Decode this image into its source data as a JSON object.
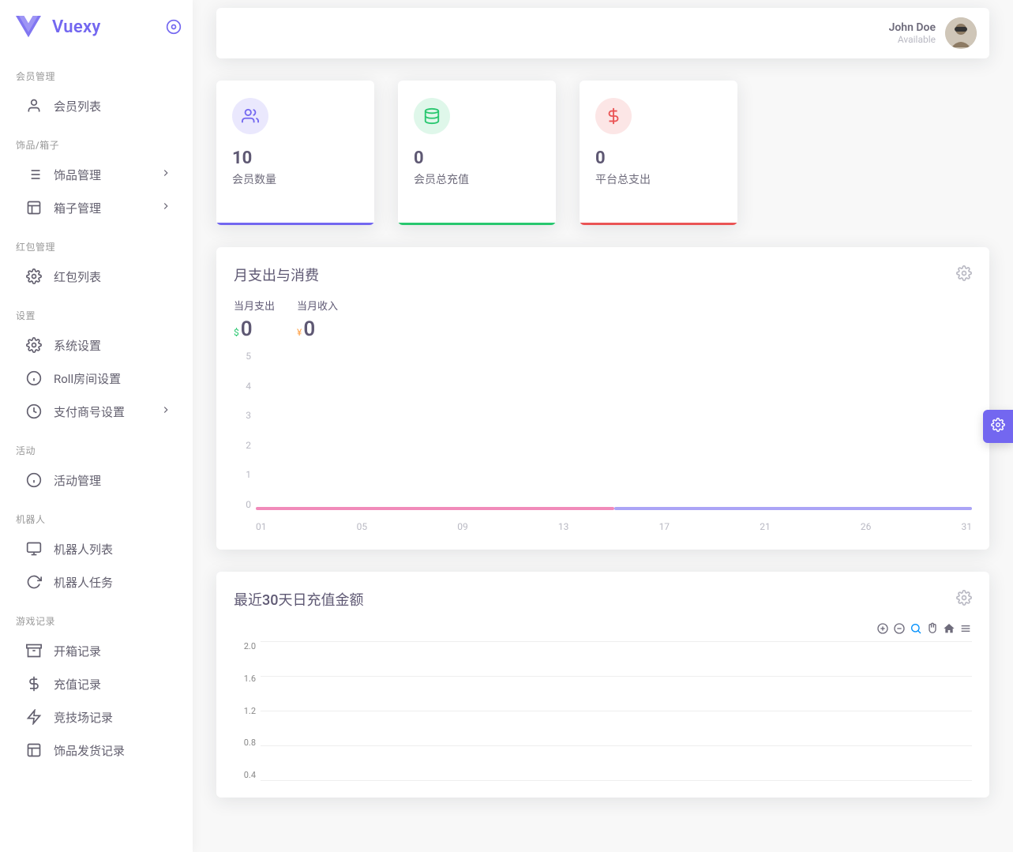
{
  "brand": {
    "name": "Vuexy"
  },
  "user": {
    "name": "John Doe",
    "status": "Available"
  },
  "sidebar": {
    "sections": [
      {
        "title": "会员管理",
        "items": [
          {
            "label": "会员列表",
            "icon": "user-icon"
          }
        ]
      },
      {
        "title": "饰品/箱子",
        "items": [
          {
            "label": "饰品管理",
            "icon": "list-icon",
            "chevron": true
          },
          {
            "label": "箱子管理",
            "icon": "layout-icon",
            "chevron": true
          }
        ]
      },
      {
        "title": "红包管理",
        "items": [
          {
            "label": "红包列表",
            "icon": "gear-icon"
          }
        ]
      },
      {
        "title": "设置",
        "items": [
          {
            "label": "系统设置",
            "icon": "gear-icon"
          },
          {
            "label": "Roll房间设置",
            "icon": "info-icon"
          },
          {
            "label": "支付商号设置",
            "icon": "clock-icon",
            "chevron": true
          }
        ]
      },
      {
        "title": "活动",
        "items": [
          {
            "label": "活动管理",
            "icon": "info-icon"
          }
        ]
      },
      {
        "title": "机器人",
        "items": [
          {
            "label": "机器人列表",
            "icon": "monitor-icon"
          },
          {
            "label": "机器人任务",
            "icon": "refresh-icon"
          }
        ]
      },
      {
        "title": "游戏记录",
        "items": [
          {
            "label": "开箱记录",
            "icon": "archive-icon"
          },
          {
            "label": "充值记录",
            "icon": "dollar-icon"
          },
          {
            "label": "竞技场记录",
            "icon": "zap-icon"
          },
          {
            "label": "饰品发货记录",
            "icon": "layout-icon"
          }
        ]
      }
    ]
  },
  "stats": [
    {
      "value": "10",
      "label": "会员数量",
      "color": "purple",
      "icon": "users-icon"
    },
    {
      "value": "0",
      "label": "会员总充值",
      "color": "green",
      "icon": "database-icon"
    },
    {
      "value": "0",
      "label": "平台总支出",
      "color": "red",
      "icon": "dollar-sign-icon"
    }
  ],
  "monthly_chart": {
    "title": "月支出与消费",
    "subtotals": [
      {
        "label": "当月支出",
        "currency": "$",
        "value": "0",
        "currency_class": "green"
      },
      {
        "label": "当月收入",
        "currency": "¥",
        "value": "0",
        "currency_class": "orange"
      }
    ]
  },
  "recharge_chart": {
    "title": "最近30天日充值金额"
  },
  "chart_data": [
    {
      "type": "line",
      "title": "月支出与消费",
      "x": [
        "01",
        "02",
        "03",
        "04",
        "05",
        "06",
        "07",
        "08",
        "09",
        "10",
        "11",
        "12",
        "13",
        "14",
        "15",
        "16",
        "17",
        "18",
        "19",
        "20",
        "21",
        "22",
        "23",
        "24",
        "25",
        "26",
        "27",
        "28",
        "29",
        "30",
        "31"
      ],
      "x_tick_labels": [
        "01",
        "05",
        "09",
        "13",
        "17",
        "21",
        "26",
        "31"
      ],
      "series": [
        {
          "name": "当月支出",
          "values": [
            0,
            0,
            0,
            0,
            0,
            0,
            0,
            0,
            0,
            0,
            0,
            0,
            0,
            0,
            0,
            0,
            0,
            0,
            0,
            0,
            0,
            0,
            0,
            0,
            0,
            0,
            0,
            0,
            0,
            0,
            0
          ]
        },
        {
          "name": "当月收入",
          "values": [
            0,
            0,
            0,
            0,
            0,
            0,
            0,
            0,
            0,
            0,
            0,
            0,
            0,
            0,
            0,
            0,
            0,
            0,
            0,
            0,
            0,
            0,
            0,
            0,
            0,
            0,
            0,
            0,
            0,
            0,
            0
          ]
        }
      ],
      "ylim": [
        0,
        5
      ],
      "y_ticks": [
        5,
        4,
        3,
        2,
        1,
        0
      ]
    },
    {
      "type": "line",
      "title": "最近30天日充值金额",
      "x": [],
      "series": [
        {
          "name": "充值金额",
          "values": []
        }
      ],
      "ylim": [
        0,
        2.0
      ],
      "y_ticks": [
        2.0,
        1.6,
        1.2,
        0.8,
        0.4
      ]
    }
  ]
}
